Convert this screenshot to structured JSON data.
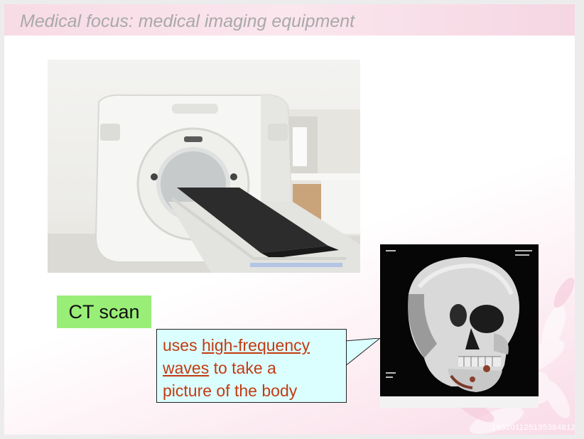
{
  "slide": {
    "title": "Medical focus: medical imaging equipment",
    "label": "CT scan",
    "callout": {
      "word1": "uses",
      "link_text_1": "high-frequency",
      "link_text_2": "waves",
      "rest_1": "to take a",
      "rest_2": "picture of the body"
    },
    "footer_right": "1652011251353848125"
  },
  "images": {
    "ct_scanner": "ct-scanner-photo",
    "skull": "3d-skull-ct-photo"
  },
  "colors": {
    "title_bar": "#f7dbe5",
    "title_text": "#a9a9a9",
    "label_bg": "#99ee77",
    "callout_bg": "#dbffff",
    "callout_text": "#c43a12"
  }
}
